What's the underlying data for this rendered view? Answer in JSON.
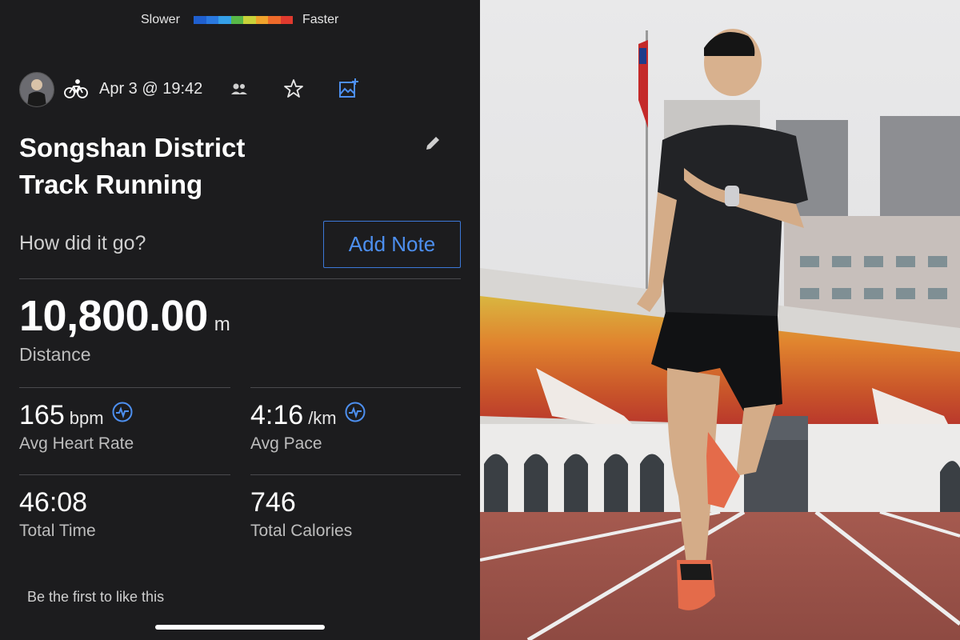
{
  "legend": {
    "slower": "Slower",
    "faster": "Faster",
    "colors": [
      "#1f5fcf",
      "#2a79e0",
      "#35a0e8",
      "#58b848",
      "#c9d23a",
      "#f0a32c",
      "#ee6a2a",
      "#e03a2e"
    ]
  },
  "header": {
    "date": "Apr 3 @ 19:42",
    "avatar_icon": "user-avatar",
    "activity_icon": "cycling-icon"
  },
  "activity": {
    "title_line1": "Songshan District",
    "title_line2": "Track Running"
  },
  "note": {
    "prompt": "How did it go?",
    "button": "Add Note"
  },
  "distance": {
    "value": "10,800.00",
    "unit": "m",
    "label": "Distance"
  },
  "stats": {
    "heart_rate": {
      "value": "165",
      "unit": "bpm",
      "label": "Avg Heart Rate"
    },
    "pace": {
      "value": "4:16",
      "unit": "/km",
      "label": "Avg Pace"
    },
    "time": {
      "value": "46:08",
      "label": "Total Time"
    },
    "calories": {
      "value": "746",
      "label": "Total Calories"
    }
  },
  "social": {
    "like_text": "Be the first to like this"
  },
  "colors": {
    "accent": "#4d8fef",
    "background": "#1c1c1e"
  }
}
